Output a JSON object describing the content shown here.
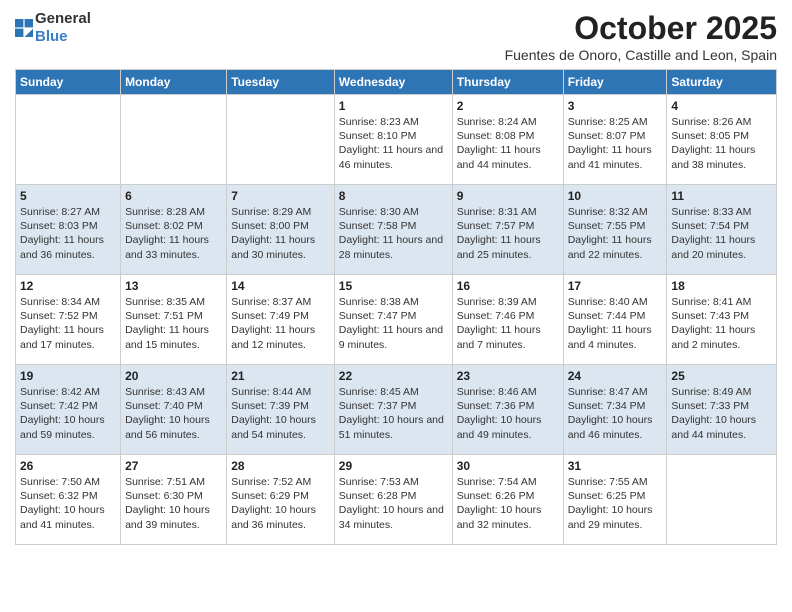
{
  "logo": {
    "general": "General",
    "blue": "Blue"
  },
  "title": "October 2025",
  "subtitle": "Fuentes de Onoro, Castille and Leon, Spain",
  "days_of_week": [
    "Sunday",
    "Monday",
    "Tuesday",
    "Wednesday",
    "Thursday",
    "Friday",
    "Saturday"
  ],
  "weeks": [
    [
      {
        "day": "",
        "info": ""
      },
      {
        "day": "",
        "info": ""
      },
      {
        "day": "",
        "info": ""
      },
      {
        "day": "1",
        "info": "Sunrise: 8:23 AM\nSunset: 8:10 PM\nDaylight: 11 hours and 46 minutes."
      },
      {
        "day": "2",
        "info": "Sunrise: 8:24 AM\nSunset: 8:08 PM\nDaylight: 11 hours and 44 minutes."
      },
      {
        "day": "3",
        "info": "Sunrise: 8:25 AM\nSunset: 8:07 PM\nDaylight: 11 hours and 41 minutes."
      },
      {
        "day": "4",
        "info": "Sunrise: 8:26 AM\nSunset: 8:05 PM\nDaylight: 11 hours and 38 minutes."
      }
    ],
    [
      {
        "day": "5",
        "info": "Sunrise: 8:27 AM\nSunset: 8:03 PM\nDaylight: 11 hours and 36 minutes."
      },
      {
        "day": "6",
        "info": "Sunrise: 8:28 AM\nSunset: 8:02 PM\nDaylight: 11 hours and 33 minutes."
      },
      {
        "day": "7",
        "info": "Sunrise: 8:29 AM\nSunset: 8:00 PM\nDaylight: 11 hours and 30 minutes."
      },
      {
        "day": "8",
        "info": "Sunrise: 8:30 AM\nSunset: 7:58 PM\nDaylight: 11 hours and 28 minutes."
      },
      {
        "day": "9",
        "info": "Sunrise: 8:31 AM\nSunset: 7:57 PM\nDaylight: 11 hours and 25 minutes."
      },
      {
        "day": "10",
        "info": "Sunrise: 8:32 AM\nSunset: 7:55 PM\nDaylight: 11 hours and 22 minutes."
      },
      {
        "day": "11",
        "info": "Sunrise: 8:33 AM\nSunset: 7:54 PM\nDaylight: 11 hours and 20 minutes."
      }
    ],
    [
      {
        "day": "12",
        "info": "Sunrise: 8:34 AM\nSunset: 7:52 PM\nDaylight: 11 hours and 17 minutes."
      },
      {
        "day": "13",
        "info": "Sunrise: 8:35 AM\nSunset: 7:51 PM\nDaylight: 11 hours and 15 minutes."
      },
      {
        "day": "14",
        "info": "Sunrise: 8:37 AM\nSunset: 7:49 PM\nDaylight: 11 hours and 12 minutes."
      },
      {
        "day": "15",
        "info": "Sunrise: 8:38 AM\nSunset: 7:47 PM\nDaylight: 11 hours and 9 minutes."
      },
      {
        "day": "16",
        "info": "Sunrise: 8:39 AM\nSunset: 7:46 PM\nDaylight: 11 hours and 7 minutes."
      },
      {
        "day": "17",
        "info": "Sunrise: 8:40 AM\nSunset: 7:44 PM\nDaylight: 11 hours and 4 minutes."
      },
      {
        "day": "18",
        "info": "Sunrise: 8:41 AM\nSunset: 7:43 PM\nDaylight: 11 hours and 2 minutes."
      }
    ],
    [
      {
        "day": "19",
        "info": "Sunrise: 8:42 AM\nSunset: 7:42 PM\nDaylight: 10 hours and 59 minutes."
      },
      {
        "day": "20",
        "info": "Sunrise: 8:43 AM\nSunset: 7:40 PM\nDaylight: 10 hours and 56 minutes."
      },
      {
        "day": "21",
        "info": "Sunrise: 8:44 AM\nSunset: 7:39 PM\nDaylight: 10 hours and 54 minutes."
      },
      {
        "day": "22",
        "info": "Sunrise: 8:45 AM\nSunset: 7:37 PM\nDaylight: 10 hours and 51 minutes."
      },
      {
        "day": "23",
        "info": "Sunrise: 8:46 AM\nSunset: 7:36 PM\nDaylight: 10 hours and 49 minutes."
      },
      {
        "day": "24",
        "info": "Sunrise: 8:47 AM\nSunset: 7:34 PM\nDaylight: 10 hours and 46 minutes."
      },
      {
        "day": "25",
        "info": "Sunrise: 8:49 AM\nSunset: 7:33 PM\nDaylight: 10 hours and 44 minutes."
      }
    ],
    [
      {
        "day": "26",
        "info": "Sunrise: 7:50 AM\nSunset: 6:32 PM\nDaylight: 10 hours and 41 minutes."
      },
      {
        "day": "27",
        "info": "Sunrise: 7:51 AM\nSunset: 6:30 PM\nDaylight: 10 hours and 39 minutes."
      },
      {
        "day": "28",
        "info": "Sunrise: 7:52 AM\nSunset: 6:29 PM\nDaylight: 10 hours and 36 minutes."
      },
      {
        "day": "29",
        "info": "Sunrise: 7:53 AM\nSunset: 6:28 PM\nDaylight: 10 hours and 34 minutes."
      },
      {
        "day": "30",
        "info": "Sunrise: 7:54 AM\nSunset: 6:26 PM\nDaylight: 10 hours and 32 minutes."
      },
      {
        "day": "31",
        "info": "Sunrise: 7:55 AM\nSunset: 6:25 PM\nDaylight: 10 hours and 29 minutes."
      },
      {
        "day": "",
        "info": ""
      }
    ]
  ]
}
